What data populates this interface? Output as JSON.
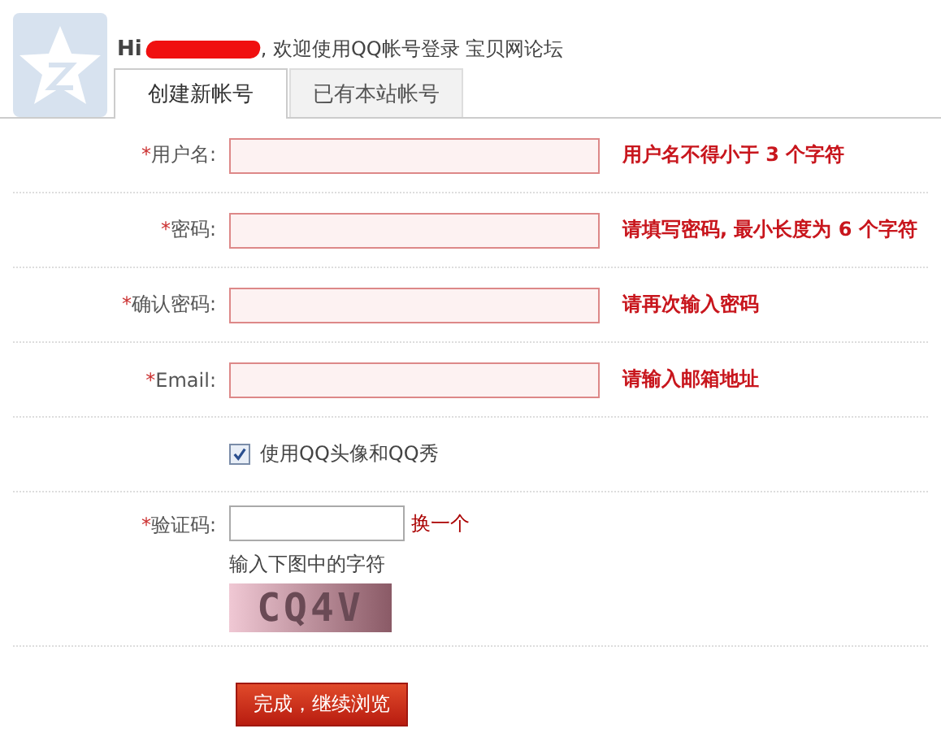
{
  "header": {
    "greeting": "Hi",
    "greeting_rest": ", 欢迎使用QQ帐号登录 宝贝网论坛"
  },
  "tabs": [
    {
      "label": "创建新帐号",
      "selected": true
    },
    {
      "label": "已有本站帐号",
      "selected": false
    }
  ],
  "fields": [
    {
      "kind": "text",
      "required_mark": "*",
      "label": "用户名:",
      "error": "用户名不得小于 3 个字符",
      "invalid": true
    },
    {
      "kind": "text",
      "required_mark": "*",
      "label": "密码:",
      "error": "请填写密码, 最小长度为 6 个字符",
      "invalid": true
    },
    {
      "kind": "text",
      "required_mark": "*",
      "label": "确认密码:",
      "error": "请再次输入密码",
      "invalid": true
    },
    {
      "kind": "text",
      "required_mark": "*",
      "label": "Email:",
      "error": "请输入邮箱地址",
      "invalid": true
    },
    {
      "kind": "checkbox",
      "label": "使用QQ头像和QQ秀",
      "checked": true
    },
    {
      "kind": "captcha",
      "required_mark": "*",
      "label": "验证码:",
      "refresh_link": "换一个",
      "hint": "输入下图中的字符",
      "captcha_text": "CQ4V"
    }
  ],
  "submit_button": "完成，继续浏览"
}
